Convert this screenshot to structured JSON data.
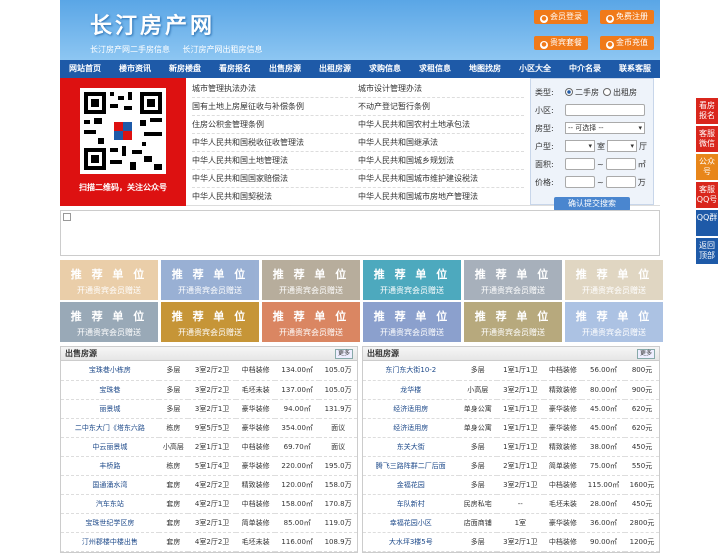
{
  "header": {
    "title": "长汀房产网",
    "subtitles": [
      "长汀房产网二手房信息",
      "长汀房产网出租房信息"
    ],
    "buttons": [
      "会员登录",
      "免费注册",
      "贵宾套餐",
      "金币充值"
    ]
  },
  "nav": [
    "网站首页",
    "楼市资讯",
    "新房楼盘",
    "看房报名",
    "出售房源",
    "出租房源",
    "求购信息",
    "求租信息",
    "地图找房",
    "小区大全",
    "中介名录",
    "联系客服"
  ],
  "qr": {
    "caption": "扫描二维码，关注公众号"
  },
  "links": {
    "left": [
      "城市管理执法办法",
      "国有土地上房屋征收与补偿条例",
      "住房公积金管理条例",
      "中华人民共和国税收征收管理法",
      "中华人民共和国土地管理法",
      "中华人民共和国国家赔偿法",
      "中华人民共和国契税法"
    ],
    "right": [
      "城市设计管理办法",
      "不动产登记暂行条例",
      "中华人民共和国农村土地承包法",
      "中华人民共和国继承法",
      "中华人民共和国城乡规划法",
      "中华人民共和国城市维护建设税法",
      "中华人民共和国城市房地产管理法"
    ]
  },
  "search": {
    "type_label": "类型:",
    "opt1": "二手房",
    "opt2": "出租房",
    "community_label": "小区:",
    "house_label": "房型:",
    "house_select": "-- 可选择 --",
    "layout_label": "户型:",
    "room": "室",
    "hall": "厅",
    "area_label": "面积:",
    "area_unit": "㎡",
    "tilde": "~",
    "price_label": "价格:",
    "price_unit": "万",
    "submit": "确认提交搜索"
  },
  "recommend": {
    "t1": "推 荐 单 位",
    "t2": "开通贵宾会员赠送",
    "colors": [
      "#e8c9a0",
      "#8fa8d0",
      "#b0a592",
      "#3aa0b8",
      "#9ea8b4",
      "#ddd2bc",
      "#8fa0b0",
      "#c08a22",
      "#d77a52",
      "#7f96c8",
      "#b0a070",
      "#a4bce0"
    ]
  },
  "sale": {
    "title": "出售房源",
    "more": "更多",
    "rows": [
      [
        "宝珠巷小栋房",
        "多层",
        "3室2厅2卫",
        "中档装修",
        "134.00㎡",
        "105.0万"
      ],
      [
        "宝珠巷",
        "多层",
        "3室2厅2卫",
        "毛坯未装",
        "137.00㎡",
        "105.0万"
      ],
      [
        "丽景城",
        "多层",
        "3室2厅1卫",
        "豪华装修",
        "94.00㎡",
        "131.9万"
      ],
      [
        "二中东大门《塔东六路",
        "栋房",
        "9室5厅5卫",
        "豪华装修",
        "354.00㎡",
        "面议"
      ],
      [
        "中云丽景城",
        "小高层",
        "2室1厅1卫",
        "中档装修",
        "69.70㎡",
        "面议"
      ],
      [
        "丰桥路",
        "栋房",
        "5室1厅4卫",
        "豪华装修",
        "220.00㎡",
        "195.0万"
      ],
      [
        "国通涌水湾",
        "套房",
        "4室2厅2卫",
        "精致装修",
        "120.00㎡",
        "158.0万"
      ],
      [
        "汽车东站",
        "套房",
        "4室2厅1卫",
        "中档装修",
        "158.00㎡",
        "170.8万"
      ],
      [
        "宝珠世纪学区房",
        "套房",
        "3室2厅1卫",
        "简单装修",
        "85.00㎡",
        "119.0万"
      ],
      [
        "汀州郡楼中楼出售",
        "套房",
        "4室2厅2卫",
        "毛坯未装",
        "116.00㎡",
        "108.9万"
      ]
    ]
  },
  "rent": {
    "title": "出租房源",
    "more": "更多",
    "rows": [
      [
        "东门东大街10-2",
        "多层",
        "1室1厅1卫",
        "中档装修",
        "56.00㎡",
        "800元"
      ],
      [
        "龙华楼",
        "小高层",
        "3室2厅1卫",
        "精致装修",
        "80.00㎡",
        "900元"
      ],
      [
        "经济适用房",
        "单身公寓",
        "1室1厅1卫",
        "豪华装修",
        "45.00㎡",
        "620元"
      ],
      [
        "经济适用房",
        "单身公寓",
        "1室1厅1卫",
        "豪华装修",
        "45.00㎡",
        "620元"
      ],
      [
        "东关大街",
        "多层",
        "1室1厅1卫",
        "精致装修",
        "38.00㎡",
        "450元"
      ],
      [
        "腾飞三路阵群二厂后面",
        "多层",
        "2室1厅1卫",
        "简单装修",
        "75.00㎡",
        "550元"
      ],
      [
        "金福花园",
        "多层",
        "3室2厅1卫",
        "中档装修",
        "115.00㎡",
        "1600元"
      ],
      [
        "车队新村",
        "民房私宅",
        "--",
        "毛坯未装",
        "28.00㎡",
        "450元"
      ],
      [
        "幸福花园小区",
        "店面商铺",
        "1室",
        "豪华装修",
        "36.00㎡",
        "2800元"
      ],
      [
        "大水坪3楼5号",
        "多层",
        "3室2厅1卫",
        "中档装修",
        "90.00㎡",
        "1200元"
      ]
    ]
  },
  "side": [
    {
      "label": "看房报名",
      "color": "#d9261c"
    },
    {
      "label": "客服微信",
      "color": "#d9261c"
    },
    {
      "label": "公众号",
      "color": "#e8861a"
    },
    {
      "label": "客服QQ号",
      "color": "#d9261c"
    },
    {
      "label": "QQ群",
      "color": "#1e5aa8"
    },
    {
      "label": "返回顶部",
      "color": "#1e5aa8"
    }
  ]
}
